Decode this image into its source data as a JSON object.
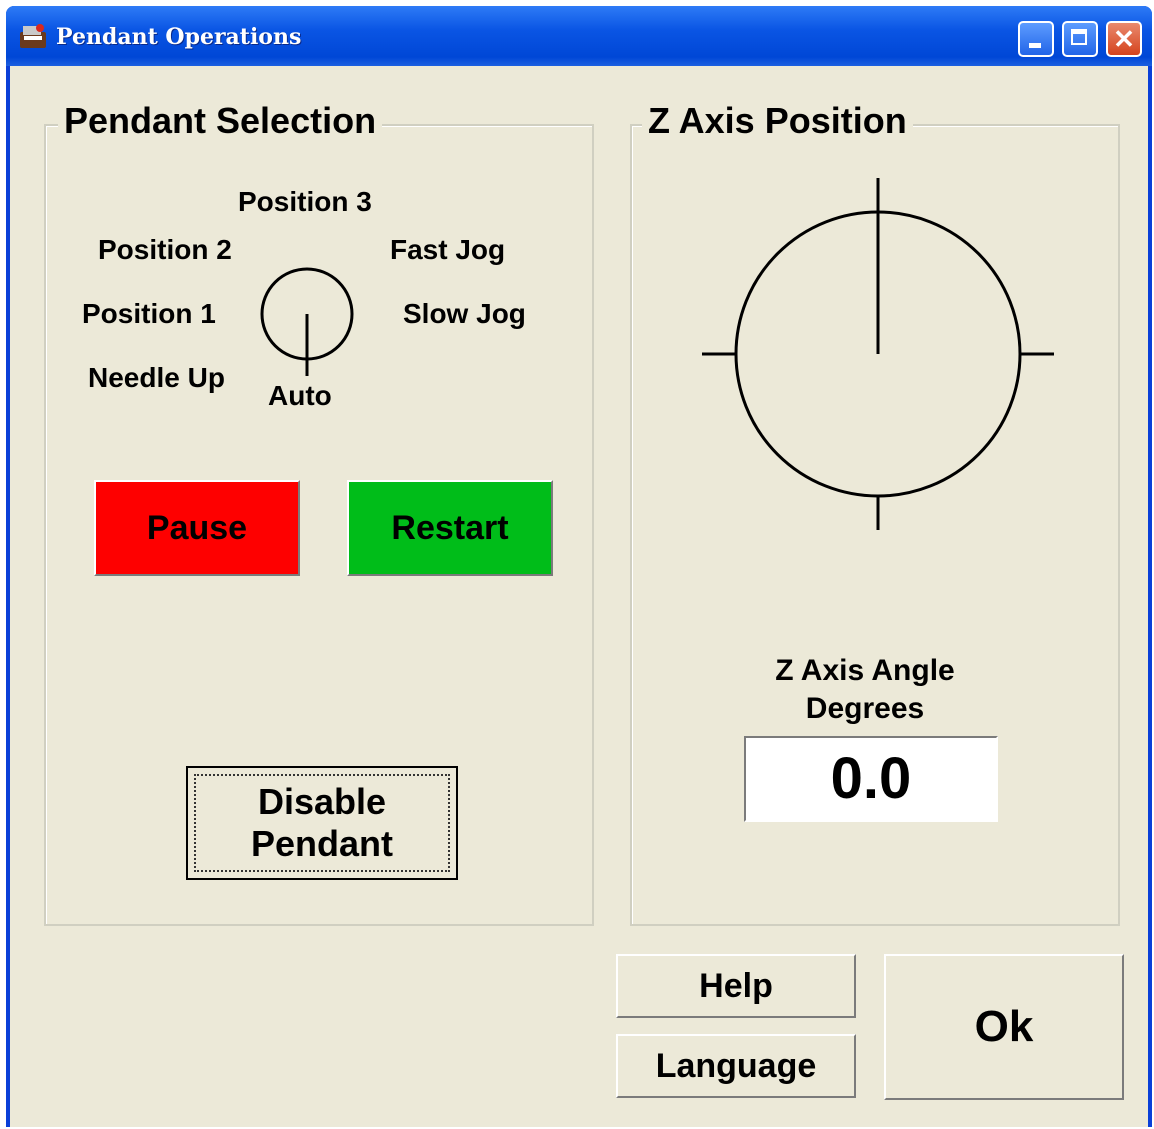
{
  "window": {
    "title": "Pendant Operations",
    "icon": "app-icon",
    "controls": [
      "minimize-icon",
      "maximize-icon",
      "close-icon"
    ],
    "close_glyph": "✕"
  },
  "pendant_selection": {
    "title": "Pendant Selection",
    "positions": {
      "position3": "Position 3",
      "position2": "Position 2",
      "fast_jog": "Fast Jog",
      "position1": "Position 1",
      "slow_jog": "Slow Jog",
      "needle_up": "Needle Up",
      "auto": "Auto"
    },
    "selected": "Auto",
    "pause_label": "Pause",
    "restart_label": "Restart",
    "disable_label_line1": "Disable",
    "disable_label_line2": "Pendant",
    "colors": {
      "pause": "#fe0000",
      "restart": "#00bd19"
    }
  },
  "z_axis": {
    "title": "Z Axis Position",
    "angle_label_line1": "Z Axis Angle",
    "angle_label_line2": "Degrees",
    "angle_value": "0.0",
    "angle_degrees": 0
  },
  "footer": {
    "help_label": "Help",
    "language_label": "Language",
    "ok_label": "Ok"
  }
}
